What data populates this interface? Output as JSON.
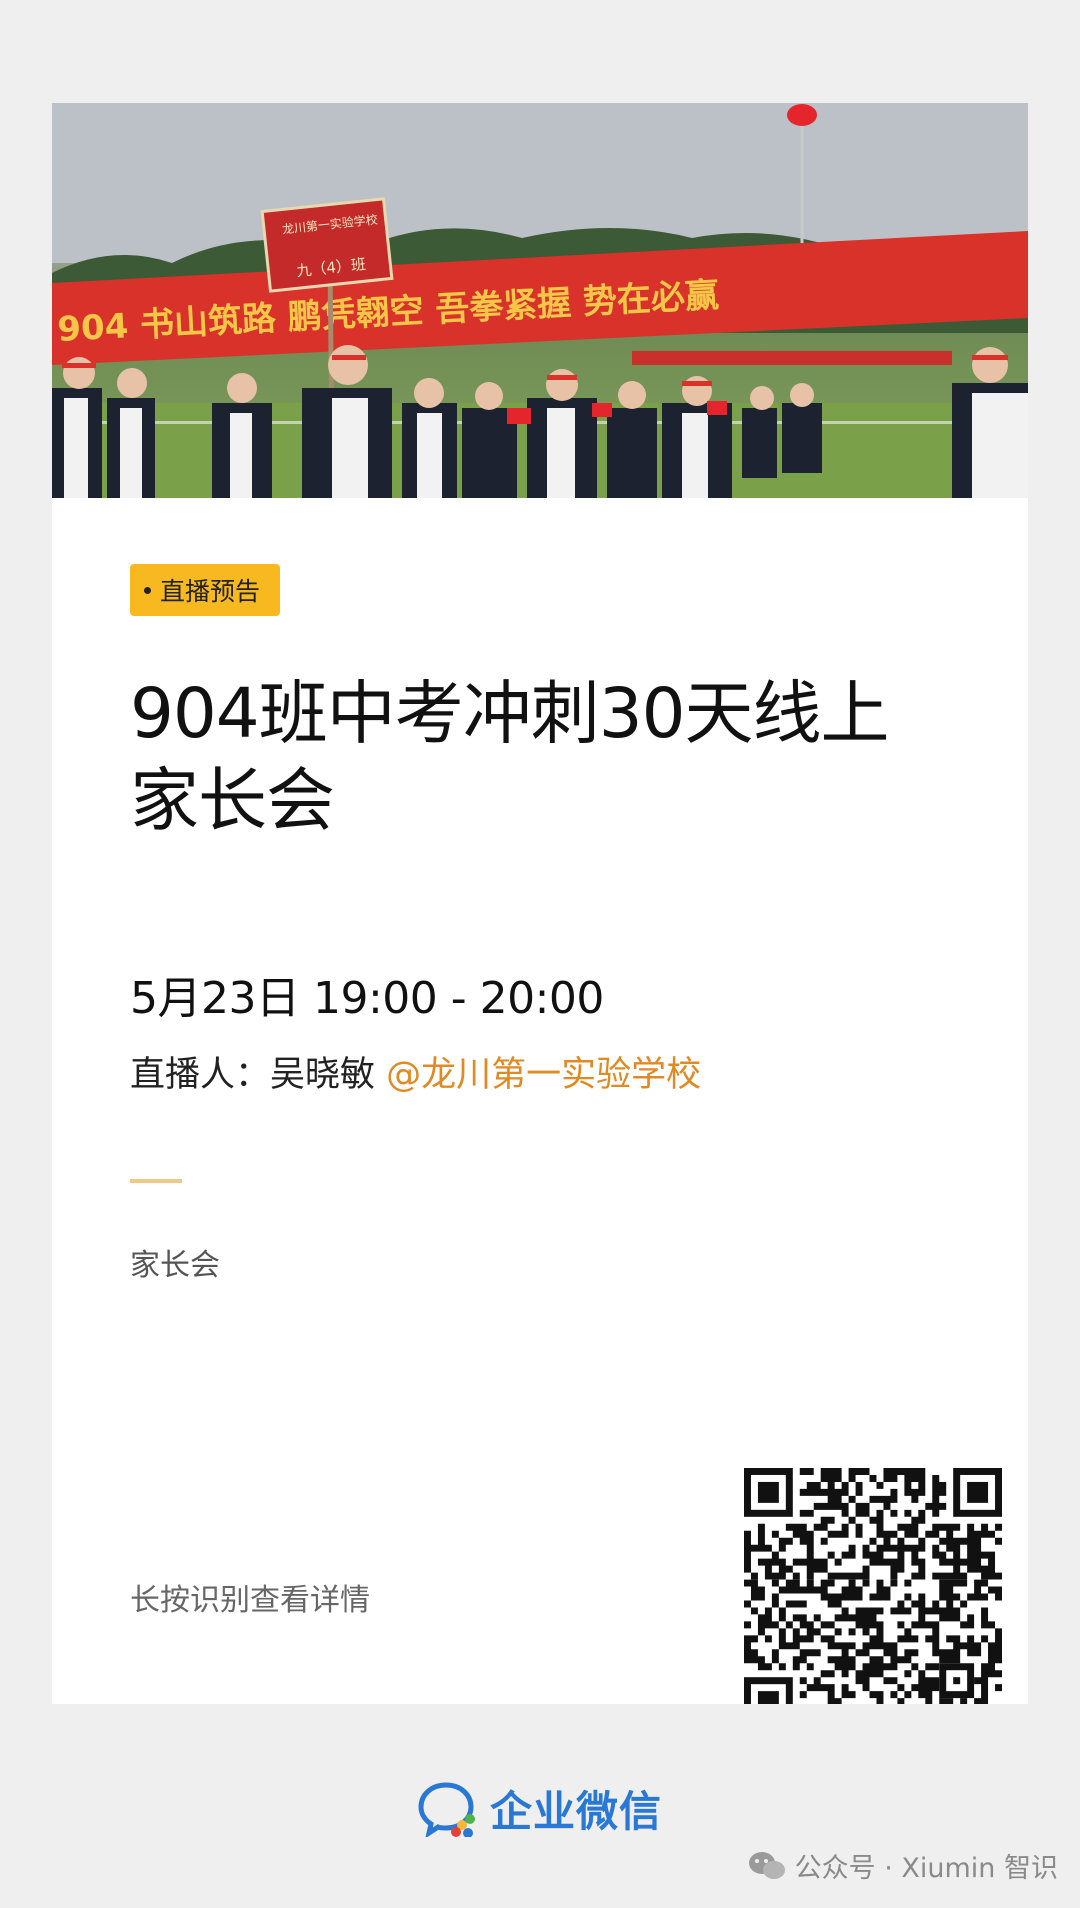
{
  "card": {
    "badge": "直播预告",
    "title_line1": "904班中考冲刺30天线上",
    "title_line2": "家长会",
    "time": "5月23日 19:00 - 20:00",
    "host_label": "直播人：吴晓敏",
    "host_org": "@龙川第一实验学校",
    "tag": "家长会",
    "hint": "长按识别查看详情"
  },
  "hero": {
    "sign_school": "龙川第一实验学校",
    "sign_class": "九（4）班",
    "banner_text": "904 书山筑路  鹏凭翱空  吾拳紧握  势在必赢"
  },
  "footer": {
    "brand": "企业微信",
    "watermark": "公众号 · Xiumin 智识"
  },
  "colors": {
    "accent": "#f7b91f",
    "org_link": "#e08a24",
    "brand_blue": "#2a78d6",
    "banner_red": "#d8322b"
  },
  "icons": {
    "badge_dot": "dot-icon",
    "brand_logo": "wecom-logo-icon",
    "watermark_logo": "wechat-icon",
    "qr": "qr-code"
  }
}
